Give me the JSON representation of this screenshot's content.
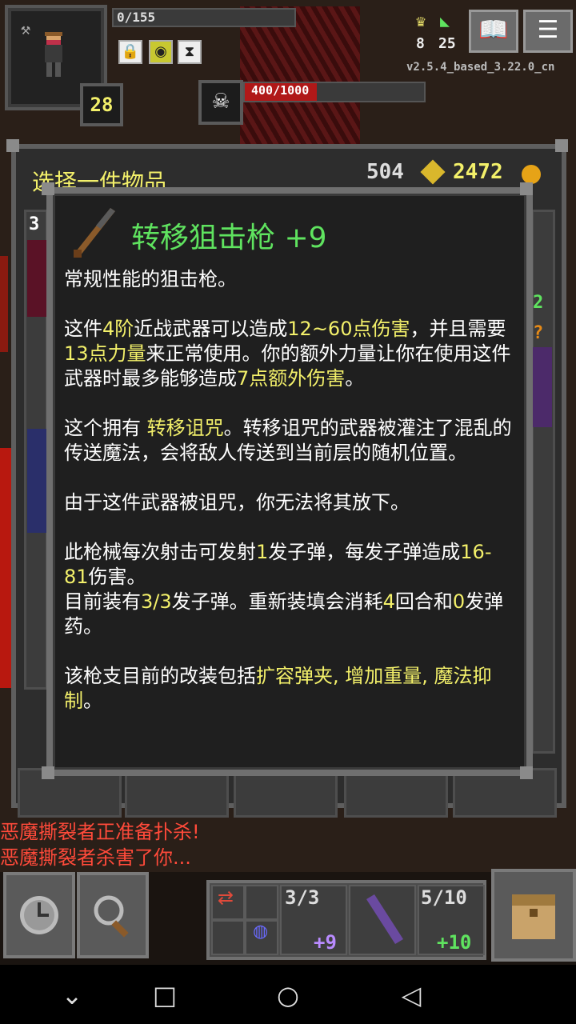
{
  "hud": {
    "exp_text": "0/155",
    "level": "28",
    "boss_hp": "400/1000",
    "version": "v2.5.4_based_3.22.0_cn",
    "stat_left": "8",
    "stat_right": "25",
    "buffs": [
      "lock-icon",
      "eye-icon",
      "hourglass-icon"
    ]
  },
  "window": {
    "title": "选择一件物品",
    "energy": "504",
    "gold": "2472",
    "side_numbers": [
      "3",
      "2",
      "?"
    ]
  },
  "item": {
    "name": "转移狙击枪 +9",
    "para1": "常规性能的狙击枪。",
    "p2": [
      "这件",
      "4阶",
      "近战武器可以造成",
      "12~60点伤害",
      "，并且需要",
      "13点力量",
      "来正常使用。你的额外力量让你在使用这件武器时最多能够造成",
      "7点额外伤害",
      "。"
    ],
    "p3": [
      "这个拥有 ",
      "转移诅咒",
      "。转移诅咒的武器被灌注了混乱的传送魔法，会将敌人传送到当前层的随机位置。"
    ],
    "para4": "由于这件武器被诅咒，你无法将其放下。",
    "p5": [
      "此枪械每次射击可发射",
      "1",
      "发子弹，每发子弹造成",
      "16-81",
      "伤害。"
    ],
    "p6": [
      "目前装有",
      "3/3",
      "发子弹。重新装填会消耗",
      "4",
      "回合和",
      "0",
      "发弹药。"
    ],
    "p7": [
      "该枪支目前的改装包括",
      "扩容弹夹, 增加重量, 魔法抑制",
      "。"
    ]
  },
  "messages": [
    {
      "text": "恶魔撕裂者正准备扑杀!",
      "color": "#ff4a3a"
    },
    {
      "text": "恶魔撕裂者杀害了你...",
      "color": "#ff4a3a"
    }
  ],
  "toolbar": {
    "slot1_count": "3/3",
    "slot1_bonus": "+9",
    "slot3_count": "5/10",
    "slot3_bonus": "+10"
  },
  "colors": {
    "highlight": "#f3f06a",
    "title_green": "#5fe35f"
  }
}
